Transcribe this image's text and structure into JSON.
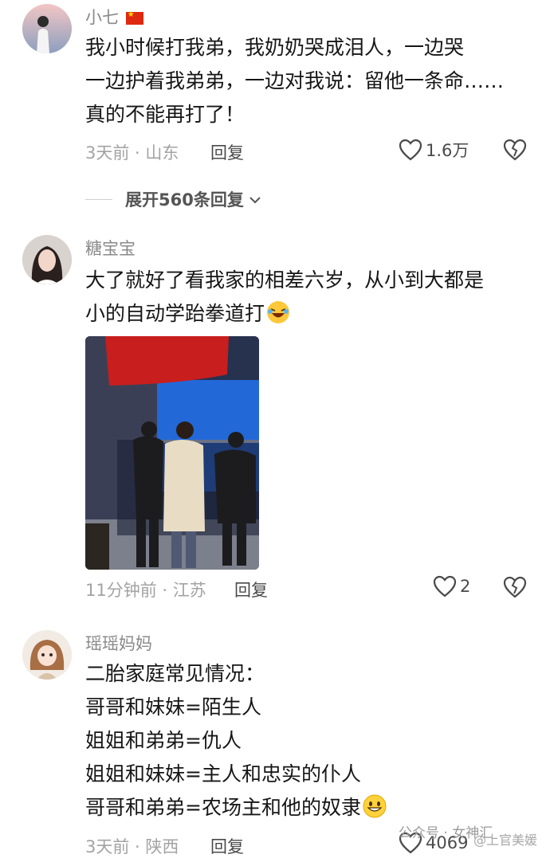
{
  "comments": [
    {
      "username": "小七",
      "text_lines": [
        "我小时候打我弟，我奶奶哭成泪人，一边哭",
        "一边护着我弟弟，一边对我说：留他一条命……",
        "真的不能再打了！"
      ],
      "meta": "3天前 · 山东",
      "reply": "回复",
      "likes": "1.6万",
      "expand": "展开560条回复"
    },
    {
      "username": "糖宝宝",
      "text_lines": [
        "大了就好了看我家的相差六岁，从小到大都是",
        "小的自动学跆拳道打"
      ],
      "meta": "11分钟前 · 江苏",
      "reply": "回复",
      "likes": "2"
    },
    {
      "username": "瑶瑶妈妈",
      "text_lines": [
        "二胎家庭常见情况：",
        "哥哥和妹妹=陌生人",
        "姐姐和弟弟=仇人",
        "姐姐和妹妹=主人和忠实的仆人",
        "哥哥和弟弟=农场主和他的奴隶"
      ],
      "meta": "3天前 · 陕西",
      "reply": "回复",
      "likes": "4069"
    }
  ],
  "watermark": {
    "source": "公众号 · 女神汇",
    "handle": "@上官美媛"
  },
  "icons": [
    "heart-outline-icon",
    "broken-heart-icon",
    "chevron-down-icon",
    "china-flag-icon",
    "rofl-emoji-icon",
    "grin-emoji-icon"
  ],
  "colors": {
    "text": "#161616",
    "meta": "#a3a3a3",
    "username": "#8a8a8a",
    "flag": "#de2910"
  }
}
